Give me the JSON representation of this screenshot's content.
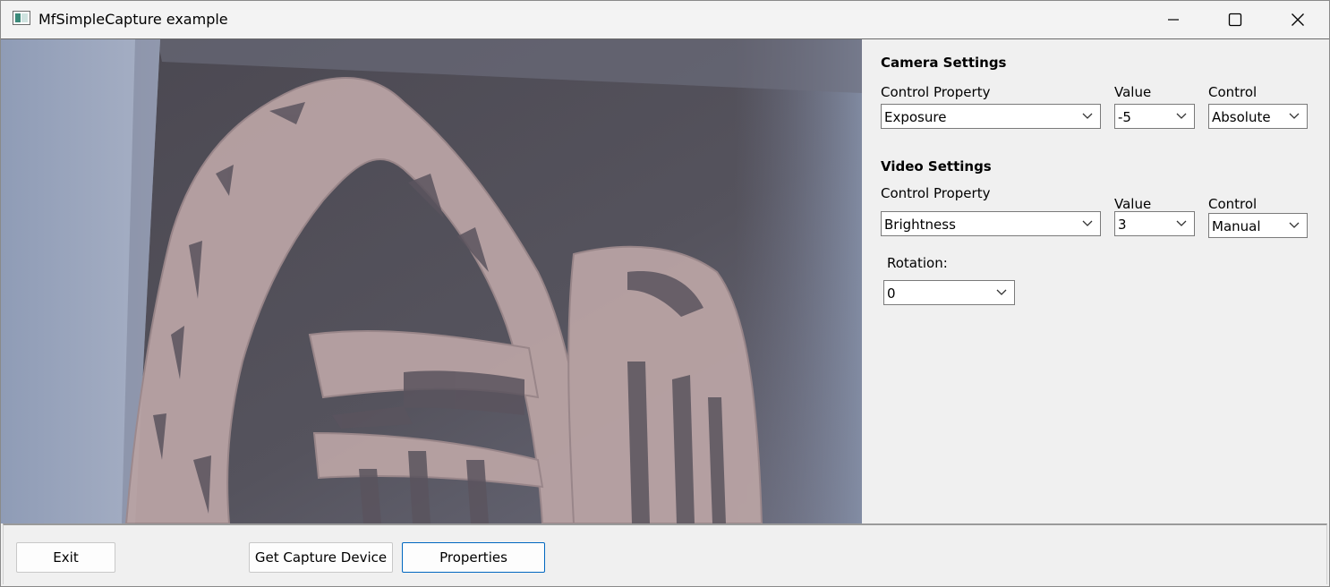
{
  "window": {
    "title": "MfSimpleCapture example",
    "minimize_icon": "minimize-icon",
    "maximize_icon": "maximize-icon",
    "close_icon": "close-icon"
  },
  "camera_settings": {
    "title": "Camera Settings",
    "property_label": "Control Property",
    "value_label": "Value",
    "control_label": "Control",
    "property_value": "Exposure",
    "value_value": "-5",
    "control_value": "Absolute"
  },
  "video_settings": {
    "title": "Video Settings",
    "property_label": "Control Property",
    "value_label": "Value",
    "control_label": "Control",
    "property_value": "Brightness",
    "value_value": "3",
    "control_value": "Manual"
  },
  "rotation": {
    "label": "Rotation:",
    "value": "0"
  },
  "buttons": {
    "exit": "Exit",
    "get_capture_device": "Get Capture Device",
    "properties": "Properties"
  },
  "colors": {
    "focus_border": "#0067c0",
    "panel_bg": "#f0f0f0"
  }
}
